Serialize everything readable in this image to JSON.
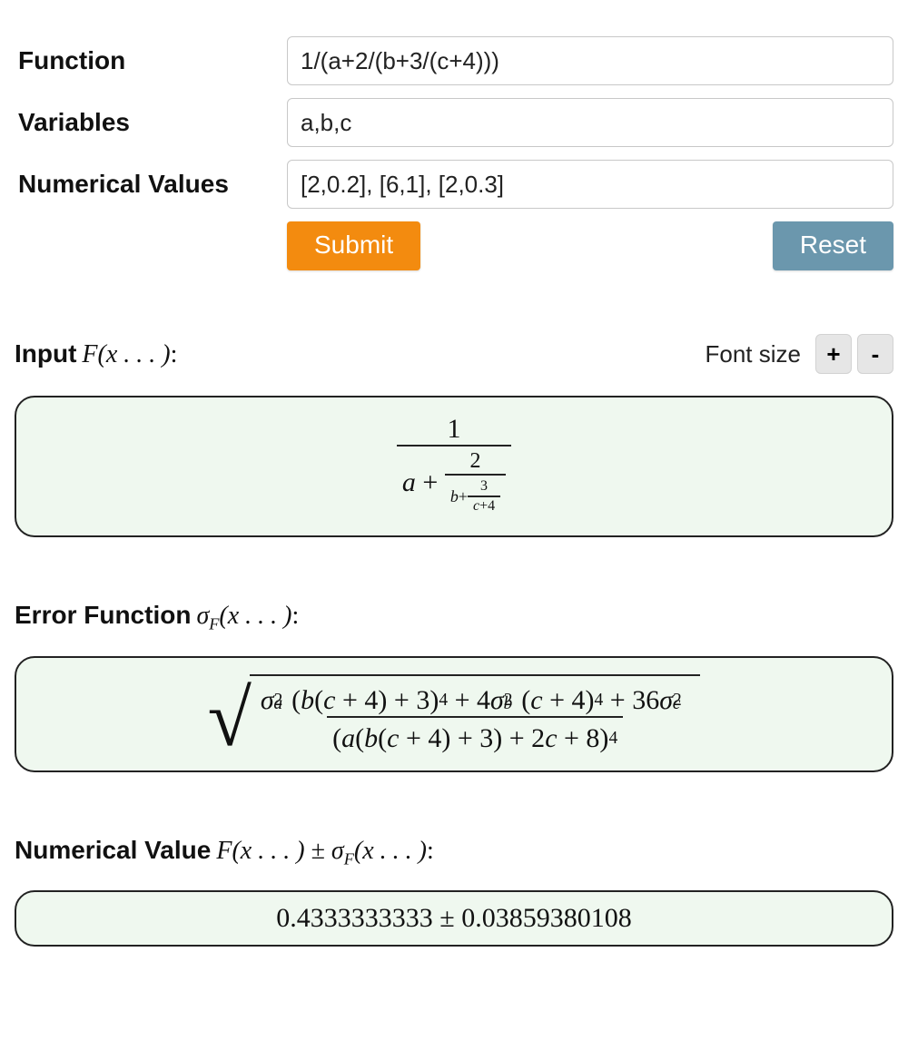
{
  "form": {
    "function_label": "Function",
    "function_value": "1/(a+2/(b+3/(c+4)))",
    "variables_label": "Variables",
    "variables_value": "a,b,c",
    "numvalues_label": "Numerical Values",
    "numvalues_value": "[2,0.2], [6,1], [2,0.3]",
    "submit_label": "Submit",
    "reset_label": "Reset"
  },
  "fontsize": {
    "label": "Font size",
    "plus": "+",
    "minus": "-"
  },
  "sections": {
    "input": {
      "label_text": "Input ",
      "label_math": "F(x . . . ):",
      "display": "1 / ( a + 2 / ( b + 3 / (c+4) ) )"
    },
    "error": {
      "label_text": "Error Function ",
      "label_math": "σ_F(x . . . ):",
      "display": "sqrt( ( σ_a^2 (b(c+4)+3)^4 + 4 σ_b^2 (c+4)^4 + 36 σ_c^2 ) / ( a(b(c+4)+3) + 2c + 8 )^4 )"
    },
    "numeric": {
      "label_text": "Numerical Value ",
      "label_math": "F(x . . . ) ± σ_F(x . . . ):",
      "display": "0.4333333333 ± 0.03859380108"
    }
  }
}
